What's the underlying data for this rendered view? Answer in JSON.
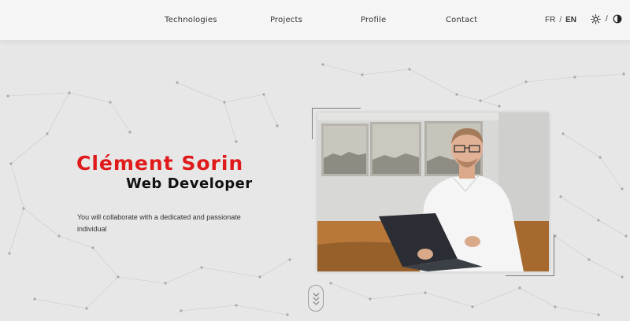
{
  "nav": {
    "items": [
      {
        "label": "Technologies"
      },
      {
        "label": "Projects"
      },
      {
        "label": "Profile"
      },
      {
        "label": "Contact"
      }
    ],
    "lang": {
      "fr": "FR",
      "separator": "/",
      "en": "EN",
      "active": "EN"
    },
    "theme": {
      "light_icon": "sun-icon",
      "separator": "/",
      "dark_icon": "contrast-icon"
    }
  },
  "hero": {
    "name": "Clément Sorin",
    "role": "Web Developer",
    "description": "You will collaborate with a dedicated and passionate individual"
  },
  "colors": {
    "accent": "#e01a1a",
    "background": "#e7e7e7",
    "header_bg": "#f5f5f5"
  }
}
